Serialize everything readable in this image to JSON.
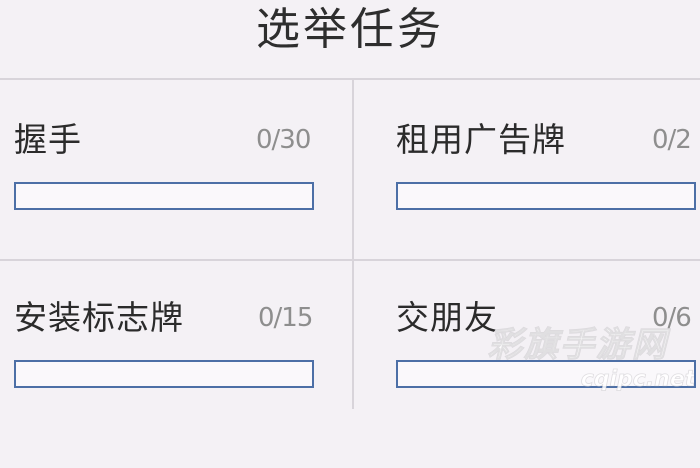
{
  "screen": {
    "title": "选举任务"
  },
  "tasks": [
    {
      "name": "握手",
      "progress": "0/30",
      "current": 0,
      "target": 30
    },
    {
      "name": "租用广告牌",
      "progress": "0/2",
      "current": 0,
      "target": 2
    },
    {
      "name": "安装标志牌",
      "progress": "0/15",
      "current": 0,
      "target": 15
    },
    {
      "name": "交朋友",
      "progress": "0/6",
      "current": 0,
      "target": 6
    }
  ],
  "watermark": {
    "brand": "彩旗手游网",
    "domain": "cqipc.net"
  },
  "colors": {
    "background": "#f4f1f5",
    "bar_border": "#4c6fa6",
    "divider": "#d8d4da",
    "count_text": "#8e8e8e"
  }
}
